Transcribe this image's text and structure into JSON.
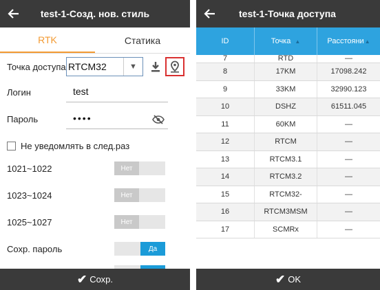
{
  "left": {
    "title": "test-1-Созд. нов. стиль",
    "tabs": [
      "RTK",
      "Статика"
    ],
    "access_point": {
      "label": "Точка доступа",
      "value": "RTCM32"
    },
    "login": {
      "label": "Логин",
      "value": "test"
    },
    "password": {
      "label": "Пароль",
      "value": "••••"
    },
    "no_notify": "Не уведомлять в след.раз",
    "toggles": [
      {
        "label": "1021~1022",
        "state": "Нет"
      },
      {
        "label": "1023~1024",
        "state": "Нет"
      },
      {
        "label": "1025~1027",
        "state": "Нет"
      },
      {
        "label": "Сохр. пароль",
        "state": "Да"
      }
    ],
    "save_label": "Сохр."
  },
  "right": {
    "title": "test-1-Точка доступа",
    "columns": [
      "ID",
      "Точка",
      "Расстояни"
    ],
    "rows": [
      {
        "id": "7",
        "point": "RTD",
        "dist": "—"
      },
      {
        "id": "8",
        "point": "17KM",
        "dist": "17098.242"
      },
      {
        "id": "9",
        "point": "33KM",
        "dist": "32990.123"
      },
      {
        "id": "10",
        "point": "DSHZ",
        "dist": "61511.045"
      },
      {
        "id": "11",
        "point": "60KM",
        "dist": "—"
      },
      {
        "id": "12",
        "point": "RTCM",
        "dist": "—"
      },
      {
        "id": "13",
        "point": "RTCM3.1",
        "dist": "—"
      },
      {
        "id": "14",
        "point": "RTCM3.2",
        "dist": "—"
      },
      {
        "id": "15",
        "point": "RTCM32-",
        "dist": "—"
      },
      {
        "id": "16",
        "point": "RTCM3MSM",
        "dist": "—"
      },
      {
        "id": "17",
        "point": "SCMRx",
        "dist": "—"
      }
    ],
    "ok_label": "OK"
  },
  "colors": {
    "dark_bar": "#3a3a3a",
    "accent_orange": "#f39a32",
    "accent_blue": "#2ea3df",
    "highlight_red": "#d93030"
  }
}
